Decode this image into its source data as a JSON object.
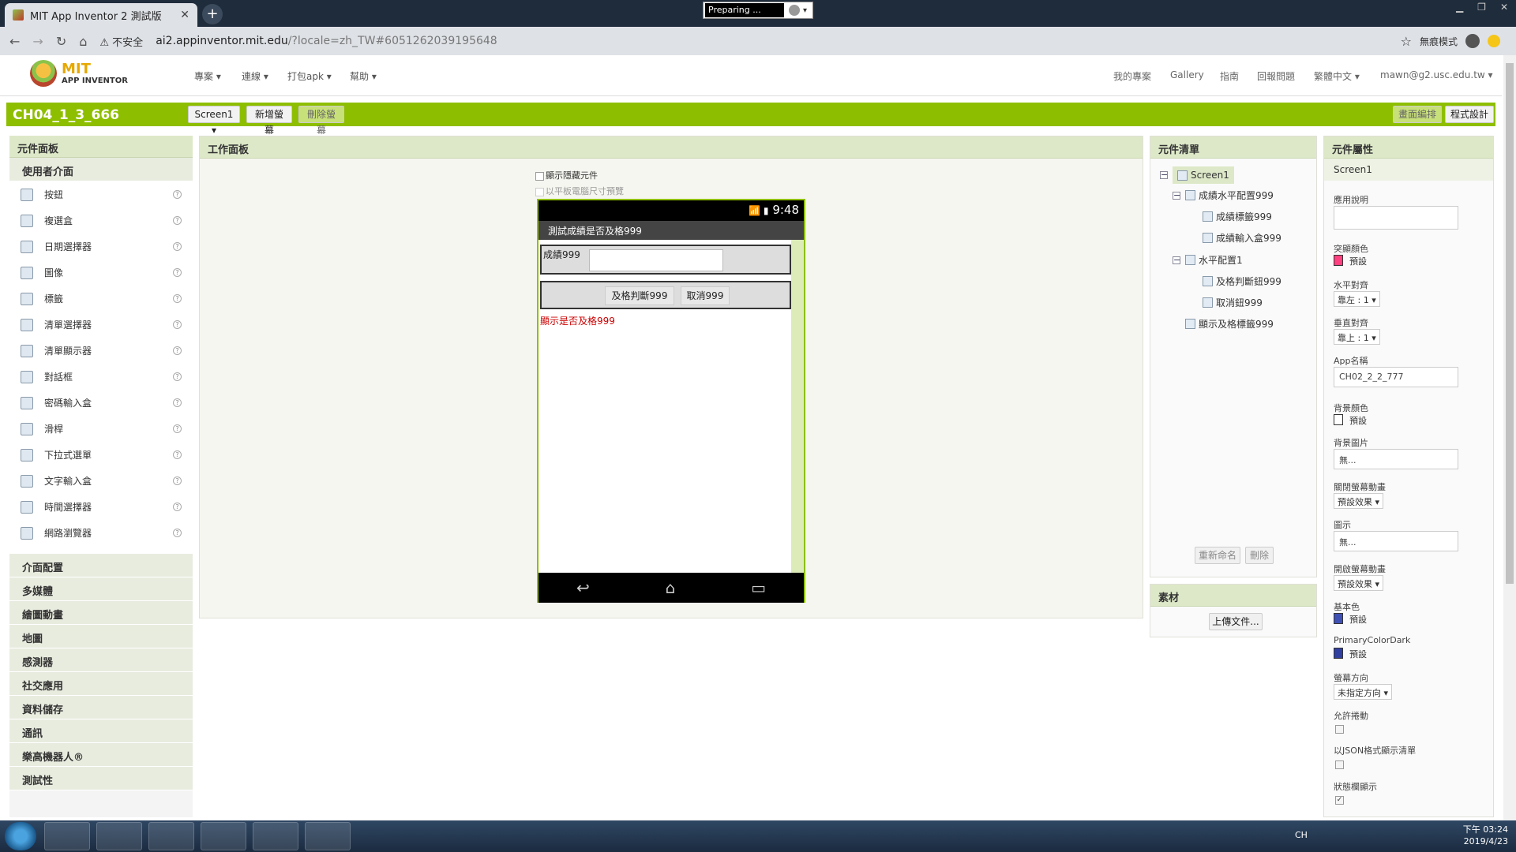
{
  "browser": {
    "tab_title": "MIT App Inventor 2 測試版",
    "preparing": "Preparing ...",
    "address_insecure": "不安全",
    "url_main": "ai2.appinventor.mit.edu",
    "url_rest": "/?locale=zh_TW#6051262039195648",
    "incognito": "無痕模式"
  },
  "header": {
    "logo_mit": "MIT",
    "logo_ai": "APP INVENTOR",
    "menus": [
      "專案 ▾",
      "連線 ▾",
      "打包apk ▾",
      "幫助 ▾"
    ],
    "right_menus": [
      "我的專案",
      "Gallery",
      "指南",
      "回報問題",
      "繁體中文 ▾",
      "mawn@g2.usc.edu.tw ▾"
    ]
  },
  "toolbar": {
    "project_name": "CH04_1_3_666",
    "screen_select": "Screen1 ▾",
    "add_screen": "新增螢幕",
    "remove_screen": "刪除螢幕",
    "designer": "畫面編排",
    "blocks": "程式設計"
  },
  "palette": {
    "title": "元件面板",
    "open_category": "使用者介面",
    "items": [
      "按鈕",
      "複選盒",
      "日期選擇器",
      "圖像",
      "標籤",
      "清單選擇器",
      "清單顯示器",
      "對話框",
      "密碼輸入盒",
      "滑桿",
      "下拉式選單",
      "文字輸入盒",
      "時間選擇器",
      "網路瀏覽器"
    ],
    "categories": [
      "介面配置",
      "多媒體",
      "繪圖動畫",
      "地圖",
      "感測器",
      "社交應用",
      "資料儲存",
      "通訊",
      "樂高機器人®",
      "測試性"
    ],
    "help": "?"
  },
  "viewer": {
    "title": "工作面板",
    "show_hidden": "顯示隱藏元件",
    "tablet_preview": "以平板電腦尺寸預覽",
    "phone": {
      "time": "9:48",
      "title": "測試成績是否及格999",
      "score_label": "成績999",
      "check_button": "及格判斷999",
      "cancel_button": "取消999",
      "result_label": "顯示是否及格999"
    }
  },
  "components": {
    "title": "元件清單",
    "tree": [
      "Screen1",
      "成績水平配置999",
      "成績標籤999",
      "成績輸入盒999",
      "水平配置1",
      "及格判斷鈕999",
      "取消鈕999",
      "顯示及格標籤999"
    ],
    "rename": "重新命名",
    "delete": "刪除"
  },
  "media": {
    "title": "素材",
    "upload": "上傳文件..."
  },
  "properties": {
    "title": "元件屬性",
    "component": "Screen1",
    "about_label": "應用說明",
    "accent_label": "突顯顏色",
    "accent_value": "預設",
    "halign_label": "水平對齊",
    "halign_value": "靠左 : 1 ▾",
    "valign_label": "垂直對齊",
    "valign_value": "靠上 : 1 ▾",
    "appname_label": "App名稱",
    "appname_value": "CH02_2_2_777",
    "bgcolor_label": "背景顏色",
    "bgcolor_value": "預設",
    "bgimage_label": "背景圖片",
    "bgimage_value": "無...",
    "close_anim_label": "關閉螢幕動畫",
    "close_anim_value": "預設效果 ▾",
    "icon_label": "圖示",
    "icon_value": "無...",
    "open_anim_label": "開啟螢幕動畫",
    "open_anim_value": "預設效果 ▾",
    "primary_label": "基本色",
    "primary_value": "預設",
    "primary_dark_label": "PrimaryColorDark",
    "primary_dark_value": "預設",
    "orientation_label": "螢幕方向",
    "orientation_value": "未指定方向 ▾",
    "scroll_label": "允許捲動",
    "json_label": "以JSON格式顯示清單",
    "statusbar_label": "狀態欄顯示",
    "colors": {
      "accent": "#ff4081",
      "bg": "#ffffff",
      "primary": "#3f51b5",
      "primary_dark": "#303f9f"
    }
  },
  "taskbar": {
    "lang": "CH",
    "time": "下午 03:24",
    "date": "2019/4/23"
  }
}
